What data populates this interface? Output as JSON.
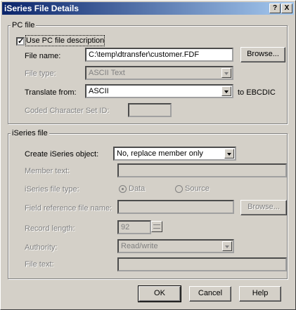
{
  "window": {
    "title": "iSeries File Details",
    "help_label": "?",
    "close_label": "X"
  },
  "pc_file": {
    "legend": "PC file",
    "use_pc_desc": {
      "label": "Use PC file description",
      "checked": true
    },
    "file_name": {
      "label": "File name:",
      "value": "C:\\temp\\dtransfer\\customer.FDF"
    },
    "browse_label": "Browse...",
    "file_type": {
      "label": "File type:",
      "value": "ASCII Text"
    },
    "translate_from": {
      "label": "Translate from:",
      "value": "ASCII",
      "suffix": "to EBCDIC"
    },
    "ccsid": {
      "label": "Coded Character Set ID:",
      "value": ""
    }
  },
  "iseries_file": {
    "legend": "iSeries file",
    "create_object": {
      "label": "Create iSeries object:",
      "value": "No, replace member only"
    },
    "member_text": {
      "label": "Member text:",
      "value": ""
    },
    "file_type": {
      "label": "iSeries file type:",
      "options": [
        "Data",
        "Source"
      ],
      "selected": "Data"
    },
    "field_ref": {
      "label": "Field reference file name:",
      "value": ""
    },
    "browse_label": "Browse...",
    "record_length": {
      "label": "Record length:",
      "value": "92"
    },
    "authority": {
      "label": "Authority:",
      "value": "Read/write"
    },
    "file_text": {
      "label": "File text:",
      "value": ""
    }
  },
  "buttons": {
    "ok": "OK",
    "cancel": "Cancel",
    "help": "Help"
  }
}
